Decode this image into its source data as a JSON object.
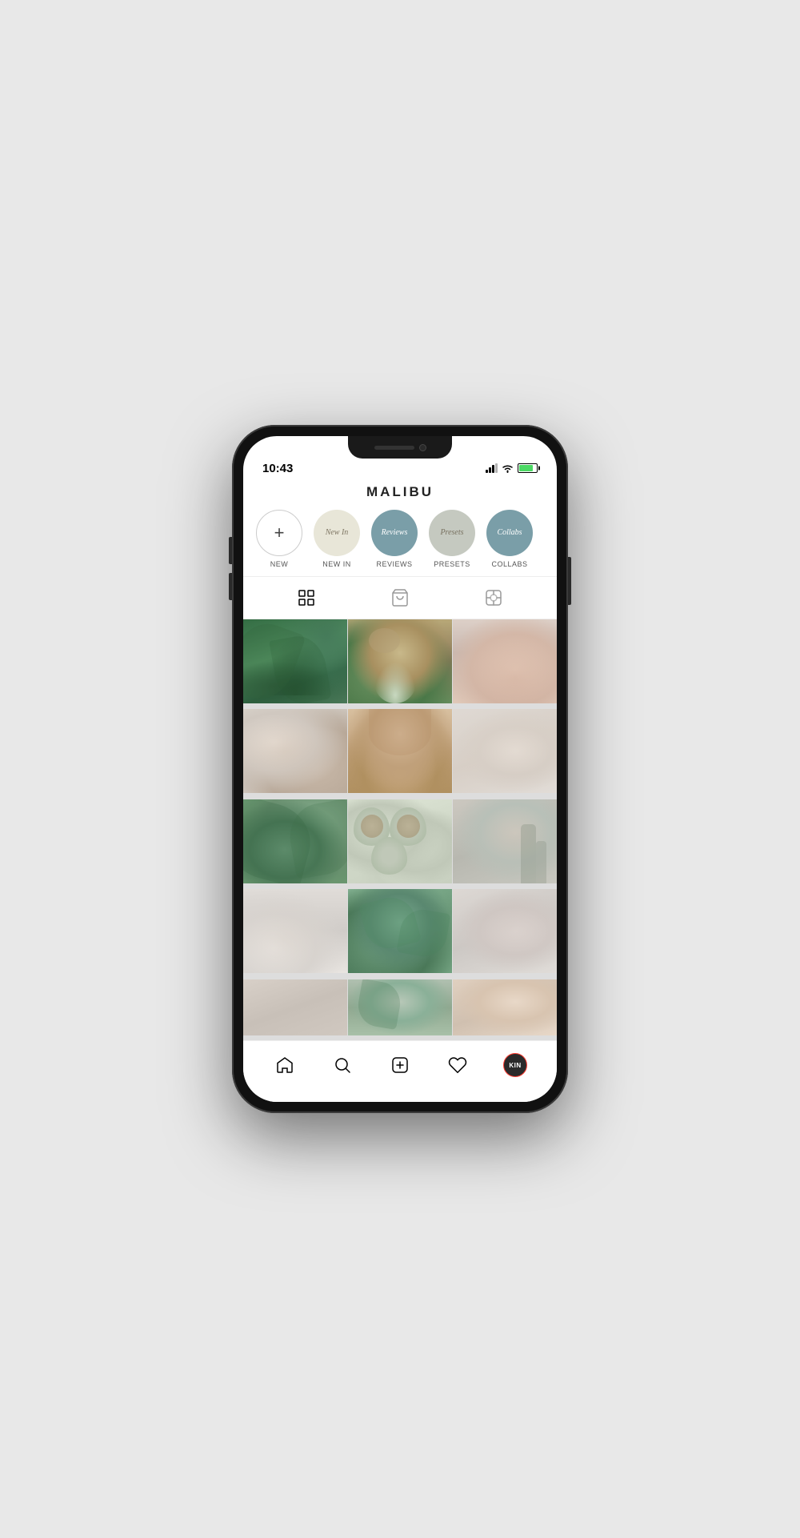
{
  "phone": {
    "time": "10:43",
    "battery_level": "80%"
  },
  "app": {
    "title": "MALIBU",
    "stories": [
      {
        "id": "new",
        "label": "New",
        "type": "new"
      },
      {
        "id": "new-in",
        "label": "NEW IN",
        "text": "New In",
        "type": "new-in"
      },
      {
        "id": "reviews",
        "label": "REVIEWS",
        "text": "Reviews",
        "type": "reviews"
      },
      {
        "id": "presets",
        "label": "PRESETS",
        "text": "Presets",
        "type": "presets"
      },
      {
        "id": "collabs",
        "label": "COLLABS",
        "text": "Collabs",
        "type": "collabs"
      }
    ],
    "tabs": [
      {
        "id": "grid",
        "label": "Grid",
        "active": true
      },
      {
        "id": "shop",
        "label": "Shop",
        "active": false
      },
      {
        "id": "tagged",
        "label": "Tagged",
        "active": false
      }
    ],
    "nav": [
      {
        "id": "home",
        "label": "Home",
        "active": true
      },
      {
        "id": "search",
        "label": "Search",
        "active": false
      },
      {
        "id": "post",
        "label": "Post",
        "active": false
      },
      {
        "id": "likes",
        "label": "Likes",
        "active": false
      },
      {
        "id": "profile",
        "label": "Profile",
        "text": "KIN",
        "active": false
      }
    ]
  },
  "colors": {
    "accent": "#7a9ea8",
    "bg": "#fff",
    "text": "#222",
    "label": "#555"
  }
}
